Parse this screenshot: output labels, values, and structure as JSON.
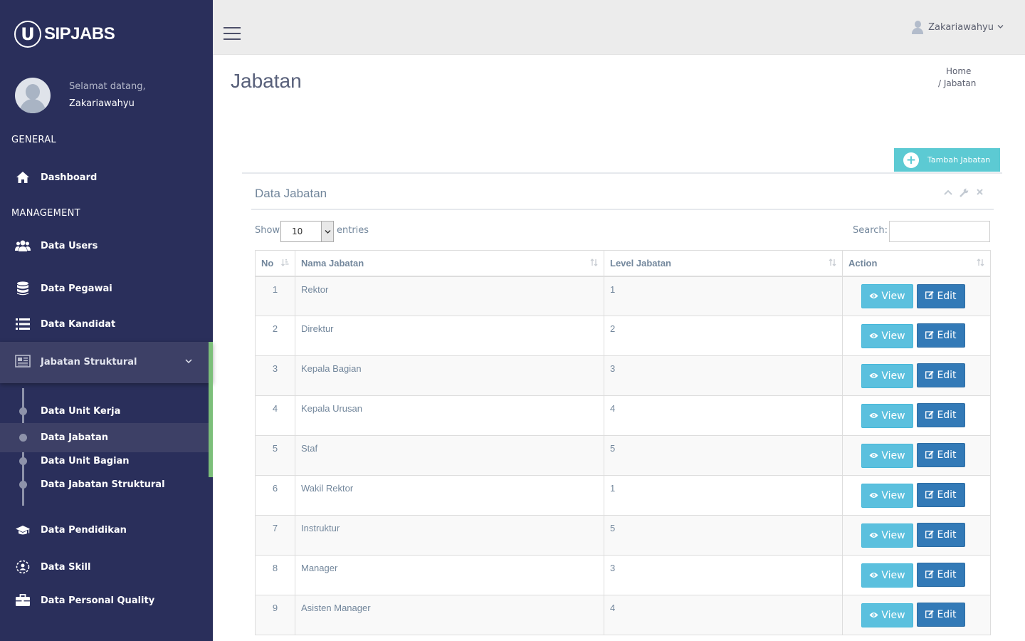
{
  "brand": {
    "logo_letter": "U",
    "name": "SIPJABS"
  },
  "profile": {
    "welcome": "Selamat datang,",
    "username": "Zakariawahyu"
  },
  "sidebar": {
    "general_label": "GENERAL",
    "management_label": "MANAGEMENT",
    "items": {
      "dashboard": "Dashboard",
      "users": "Data Users",
      "pegawai": "Data Pegawai",
      "kandidat": "Data Kandidat",
      "jabatan_struktural": "Jabatan Struktural",
      "pendidikan": "Data Pendidikan",
      "skill": "Data Skill",
      "personal_quality": "Data Personal Quality"
    },
    "sub_items": [
      "Data Unit Kerja",
      "Data Jabatan",
      "Data Unit Bagian",
      "Data Jabatan Struktural"
    ]
  },
  "topbar": {
    "user": "Zakariawahyu"
  },
  "page": {
    "title": "Jabatan",
    "breadcrumb_home": "Home",
    "breadcrumb_current": "/ Jabatan",
    "add_button": "Tambah Jabatan"
  },
  "panel": {
    "title": "Data Jabatan",
    "show_label": "Show",
    "entries_value": "10",
    "entries_label": "entries",
    "search_label": "Search:"
  },
  "table": {
    "headers": {
      "no": "No",
      "nama": "Nama Jabatan",
      "level": "Level Jabatan",
      "action": "Action"
    },
    "view_label": "View",
    "edit_label": "Edit",
    "rows": [
      {
        "no": "1",
        "nama": "Rektor",
        "level": "1"
      },
      {
        "no": "2",
        "nama": "Direktur",
        "level": "2"
      },
      {
        "no": "3",
        "nama": "Kepala Bagian",
        "level": "3"
      },
      {
        "no": "4",
        "nama": "Kepala Urusan",
        "level": "4"
      },
      {
        "no": "5",
        "nama": "Staf",
        "level": "5"
      },
      {
        "no": "6",
        "nama": "Wakil Rektor",
        "level": "1"
      },
      {
        "no": "7",
        "nama": "Instruktur",
        "level": "5"
      },
      {
        "no": "8",
        "nama": "Manager",
        "level": "3"
      },
      {
        "no": "9",
        "nama": "Asisten Manager",
        "level": "4"
      }
    ]
  },
  "colors": {
    "sidebar_bg": "#2a2f5b",
    "active_bg": "#3d4066",
    "accent_green": "#7cbf7a",
    "add_button": "#5ccad3",
    "view_button": "#5bc0de",
    "edit_button": "#337ab7"
  }
}
